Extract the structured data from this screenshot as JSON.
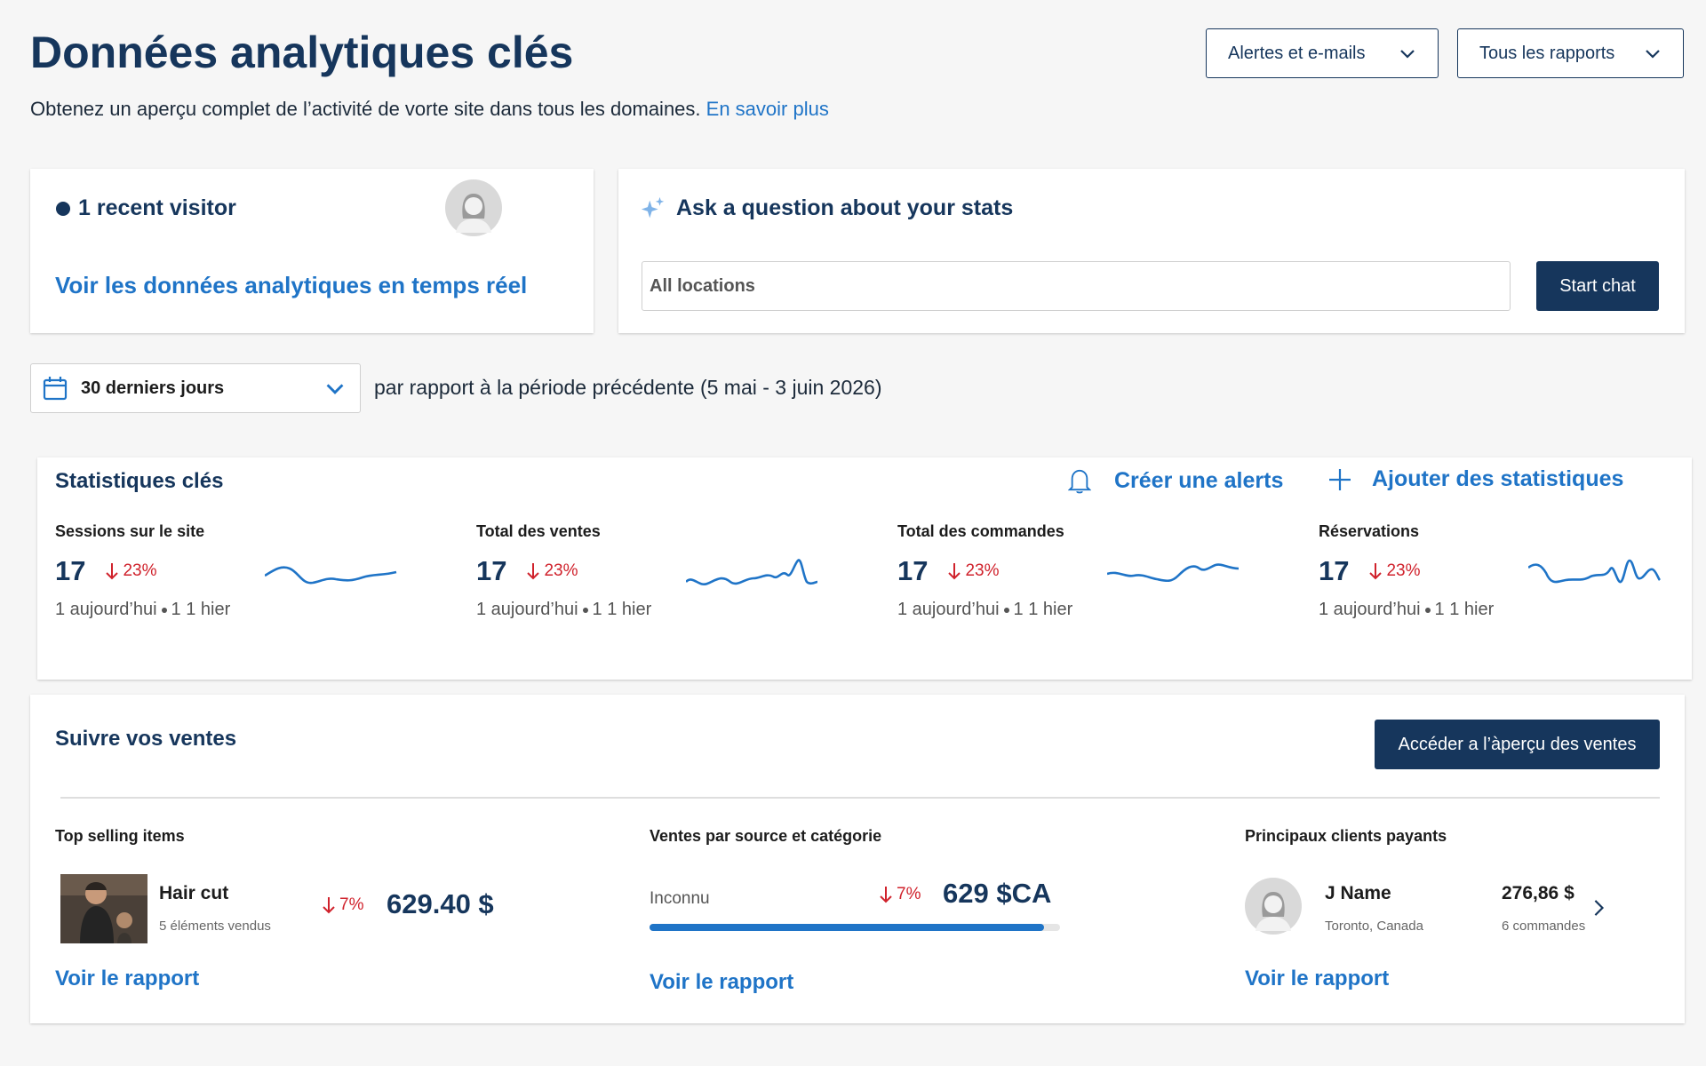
{
  "header": {
    "title": "Données analytiques clés",
    "subtitle": "Obtenez un aperçu complet de l’activité de vorte site dans tous les domaines.",
    "learn_more": "En savoir plus",
    "alerts_dropdown": "Alertes et e-mails",
    "reports_dropdown": "Tous les rapports"
  },
  "visitor_card": {
    "count_label": "1 recent visitor",
    "realtime_link": "Voir les données analytiques en temps réel"
  },
  "ask_card": {
    "title": "Ask a question about your stats",
    "input_value": "All locations",
    "start_chat": "Start chat"
  },
  "period": {
    "selected": "30 derniers jours",
    "comparison": "par rapport à la période précédente (5 mai - 3 juin 2026)"
  },
  "key_stats": {
    "title": "Statistiques clés",
    "create_alert": "Créer une alerts",
    "add_stats": "Ajouter des statistiques",
    "items": [
      {
        "title": "Sessions sur le site",
        "value": "17",
        "delta": "23%",
        "today": "1 aujourd’hui",
        "yesterday": "1 1 hier"
      },
      {
        "title": "Total des ventes",
        "value": "17",
        "delta": "23%",
        "today": "1 aujourd’hui",
        "yesterday": "1 1 hier"
      },
      {
        "title": "Total des commandes",
        "value": "17",
        "delta": "23%",
        "today": "1 aujourd’hui",
        "yesterday": "1 1 hier"
      },
      {
        "title": "Réservations",
        "value": "17",
        "delta": "23%",
        "today": "1 aujourd’hui",
        "yesterday": "1 1 hier"
      }
    ]
  },
  "sales": {
    "title": "Suivre vos ventes",
    "overview_button": "Accéder a l’àperçu des ventes",
    "top_items": {
      "heading": "Top selling items",
      "item_name": "Hair cut",
      "item_sub": "5 éléments vendus",
      "delta": "7%",
      "amount": "629.40 $",
      "report_link": "Voir le rapport"
    },
    "by_source": {
      "heading": "Ventes par source et catégorie",
      "source": "Inconnu",
      "delta": "7%",
      "amount": "629 $CA",
      "progress": 0.96,
      "report_link": "Voir le rapport"
    },
    "top_clients": {
      "heading": "Principaux clients payants",
      "client_name": "J Name",
      "client_location": "Toronto, Canada",
      "amount": "276,86 $",
      "orders": "6 commandes",
      "report_link": "Voir le rapport"
    }
  },
  "colors": {
    "navy": "#16365c",
    "link_blue": "#1f74c7",
    "negative_red": "#d0222c",
    "sparkline": "#1f74c7",
    "page_bg": "#f6f6f6"
  }
}
